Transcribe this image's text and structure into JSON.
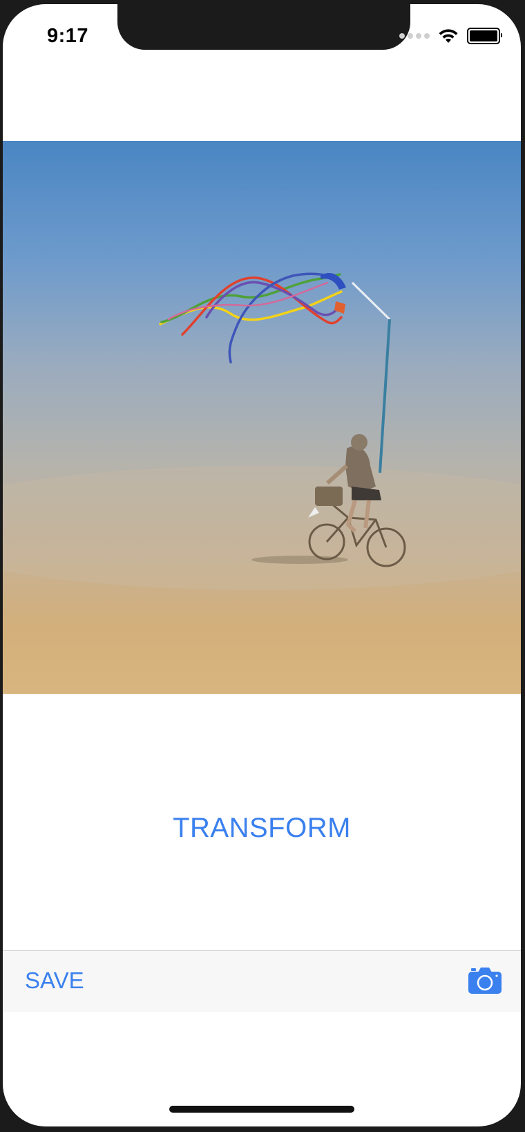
{
  "status_bar": {
    "time": "9:17",
    "icons": [
      "cellular-signal-icon",
      "wifi-icon",
      "battery-icon"
    ]
  },
  "photo": {
    "subject": "photo-image",
    "icon": "image"
  },
  "main": {
    "transform_label": "TRANSFORM"
  },
  "toolbar": {
    "save_label": "SAVE",
    "camera_icon": "camera-icon"
  },
  "colors": {
    "accent": "#3a80ee",
    "toolbar_bg": "#f7f7f7",
    "frame": "#1b1b1b"
  }
}
